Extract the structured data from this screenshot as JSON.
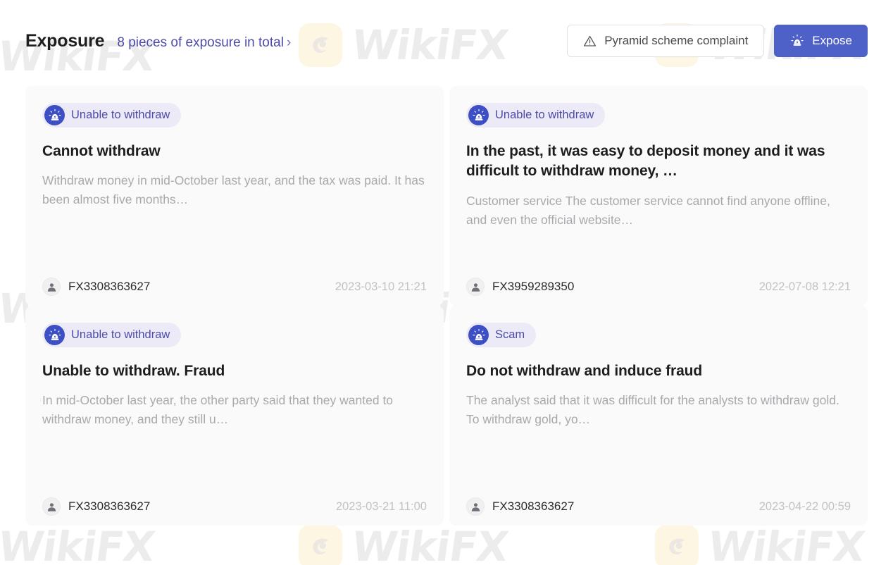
{
  "header": {
    "title": "Exposure",
    "count_link": "8 pieces of exposure in total",
    "chevron": "›",
    "pyramid_button": {
      "label": "Pyramid scheme complaint",
      "icon": "warning-triangle-icon"
    },
    "expose_button": {
      "label": "Expose",
      "icon": "siren-icon"
    }
  },
  "theme": {
    "accent": "#4e61c8",
    "badge_text": "#4c4ca8",
    "badge_bg": "#eceaf6",
    "card_bg": "#fafafa",
    "link": "#4c4ca8",
    "muted_text": "#a9a9ad",
    "date_text": "#c2c2c6"
  },
  "watermark": {
    "text": "WikiFX",
    "logo": "wikifx-eagle-logo"
  },
  "cards": [
    {
      "badge": "Unable to withdraw",
      "badge_icon": "siren-icon",
      "title": "Cannot withdraw",
      "summary": "Withdraw money in mid-October last year, and the tax was paid. It has been almost five months…",
      "author": "FX3308363627",
      "date": "2023-03-10 21:21"
    },
    {
      "badge": "Unable to withdraw",
      "badge_icon": "siren-icon",
      "title": "In the past, it was easy to deposit money and it was difficult to withdraw money, …",
      "summary": "Customer service The customer service cannot find anyone offline, and even the official website…",
      "author": "FX3959289350",
      "date": "2022-07-08 12:21"
    },
    {
      "badge": "Unable to withdraw",
      "badge_icon": "siren-icon",
      "title": "Unable to withdraw. Fraud",
      "summary": "In mid-October last year, the other party said that they wanted to withdraw money, and they still u…",
      "author": "FX3308363627",
      "date": "2023-03-21 11:00"
    },
    {
      "badge": "Scam",
      "badge_icon": "siren-icon",
      "title": "Do not withdraw and induce fraud",
      "summary": "The analyst said that it was difficult for the analysts to withdraw gold. To withdraw gold, yo…",
      "author": "FX3308363627",
      "date": "2023-04-22 00:59"
    }
  ]
}
